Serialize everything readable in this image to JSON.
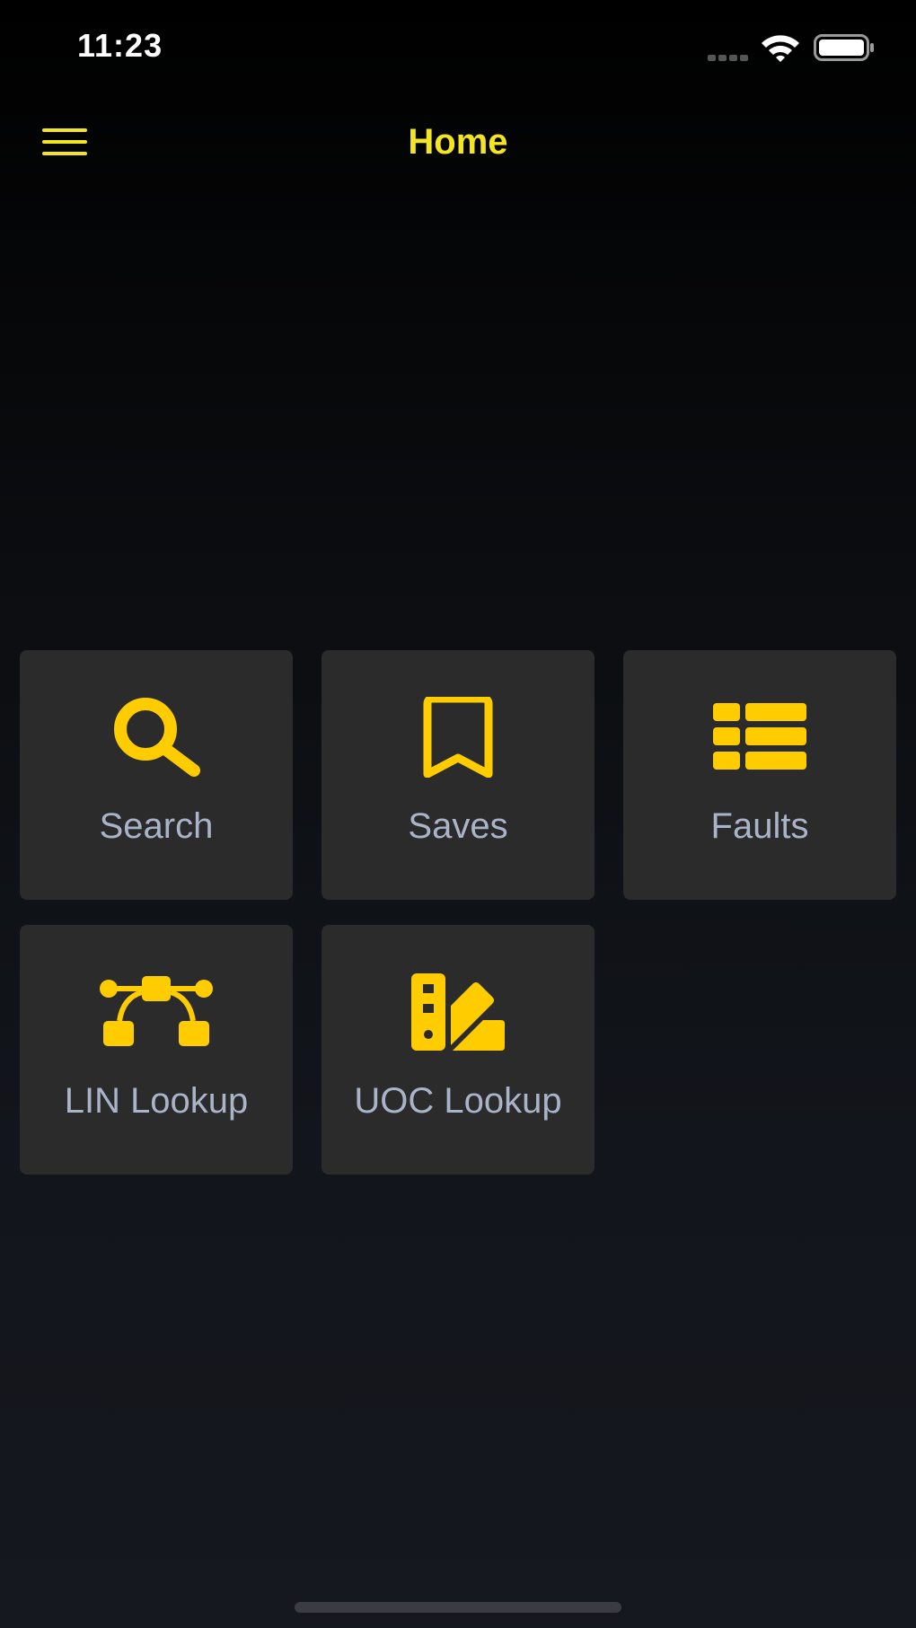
{
  "status_bar": {
    "time": "11:23",
    "icons": [
      "signal-icon",
      "wifi-icon",
      "battery-icon"
    ]
  },
  "nav": {
    "title": "Home",
    "menu_icon": "hamburger-menu-icon"
  },
  "tiles": [
    {
      "label": "Search",
      "icon": "search-icon"
    },
    {
      "label": "Saves",
      "icon": "bookmark-icon"
    },
    {
      "label": "Faults",
      "icon": "list-icon"
    },
    {
      "label": "LIN Lookup",
      "icon": "vector-nodes-icon"
    },
    {
      "label": "UOC Lookup",
      "icon": "swatchbook-icon"
    }
  ],
  "colors": {
    "accent": "#ffcc00",
    "title": "#f5e520",
    "tile_background": "#2b2b2c",
    "tile_label": "#a9b4c9"
  }
}
